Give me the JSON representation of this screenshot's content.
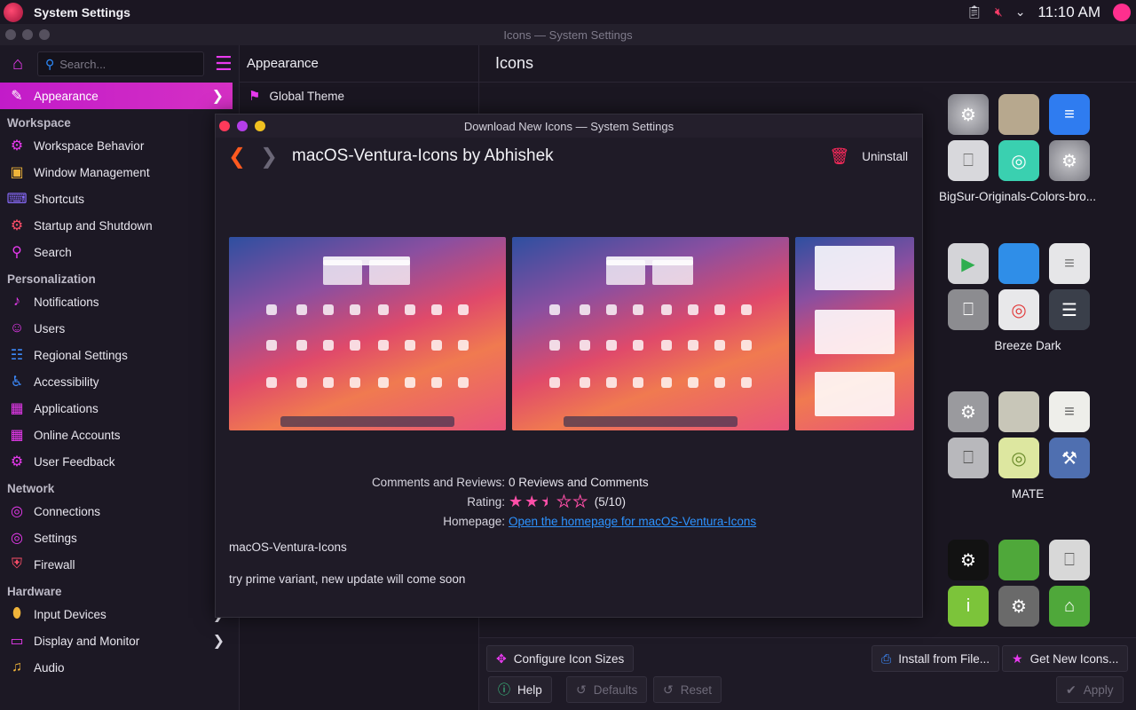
{
  "topbar": {
    "app_name": "System Settings",
    "clock": "11:10 AM",
    "icons": [
      "clipboard-icon",
      "volume-muted-icon",
      "chevron-down-icon"
    ]
  },
  "window": {
    "title": "Icons — System Settings"
  },
  "sidebar": {
    "search_placeholder": "Search...",
    "active_item": "Appearance",
    "workspace_header": "Workspace",
    "workspace_items": [
      "Workspace Behavior",
      "Window Management",
      "Shortcuts",
      "Startup and Shutdown",
      "Search"
    ],
    "personalization_header": "Personalization",
    "personalization_items": [
      "Notifications",
      "Users",
      "Regional Settings",
      "Accessibility",
      "Applications",
      "Online Accounts",
      "User Feedback"
    ],
    "network_header": "Network",
    "network_items": [
      "Connections",
      "Settings",
      "Firewall"
    ],
    "hardware_header": "Hardware",
    "hardware_items": [
      "Input Devices",
      "Display and Monitor",
      "Audio"
    ]
  },
  "midpane": {
    "title": "Appearance",
    "item": "Global Theme"
  },
  "mainpane": {
    "title": "Icons",
    "themes": [
      "BigSur-Originals-Colors-bro...",
      "Breeze Dark",
      "MATE"
    ]
  },
  "bottombar": {
    "configure": "Configure Icon Sizes",
    "install": "Install from File...",
    "get_new": "Get New Icons...",
    "help": "Help",
    "defaults": "Defaults",
    "reset": "Reset",
    "apply": "Apply"
  },
  "dialog": {
    "title": "Download New Icons — System Settings",
    "heading": "macOS-Ventura-Icons by Abhishek",
    "uninstall": "Uninstall",
    "comments_label": "Comments and Reviews:",
    "comments_value": "0 Reviews and Comments",
    "rating_label": "Rating:",
    "rating": 5,
    "rating_max": 10,
    "rating_text": "(5/10)",
    "homepage_label": "Homepage:",
    "homepage_link": "Open the homepage for macOS-Ventura-Icons",
    "description_title": "macOS-Ventura-Icons",
    "description_body": "try prime variant, new update will come soon"
  },
  "colors": {
    "accent": "#e93af0",
    "link": "#2d93ff",
    "danger": "#ff2a5c",
    "back": "#ff5a1f"
  }
}
